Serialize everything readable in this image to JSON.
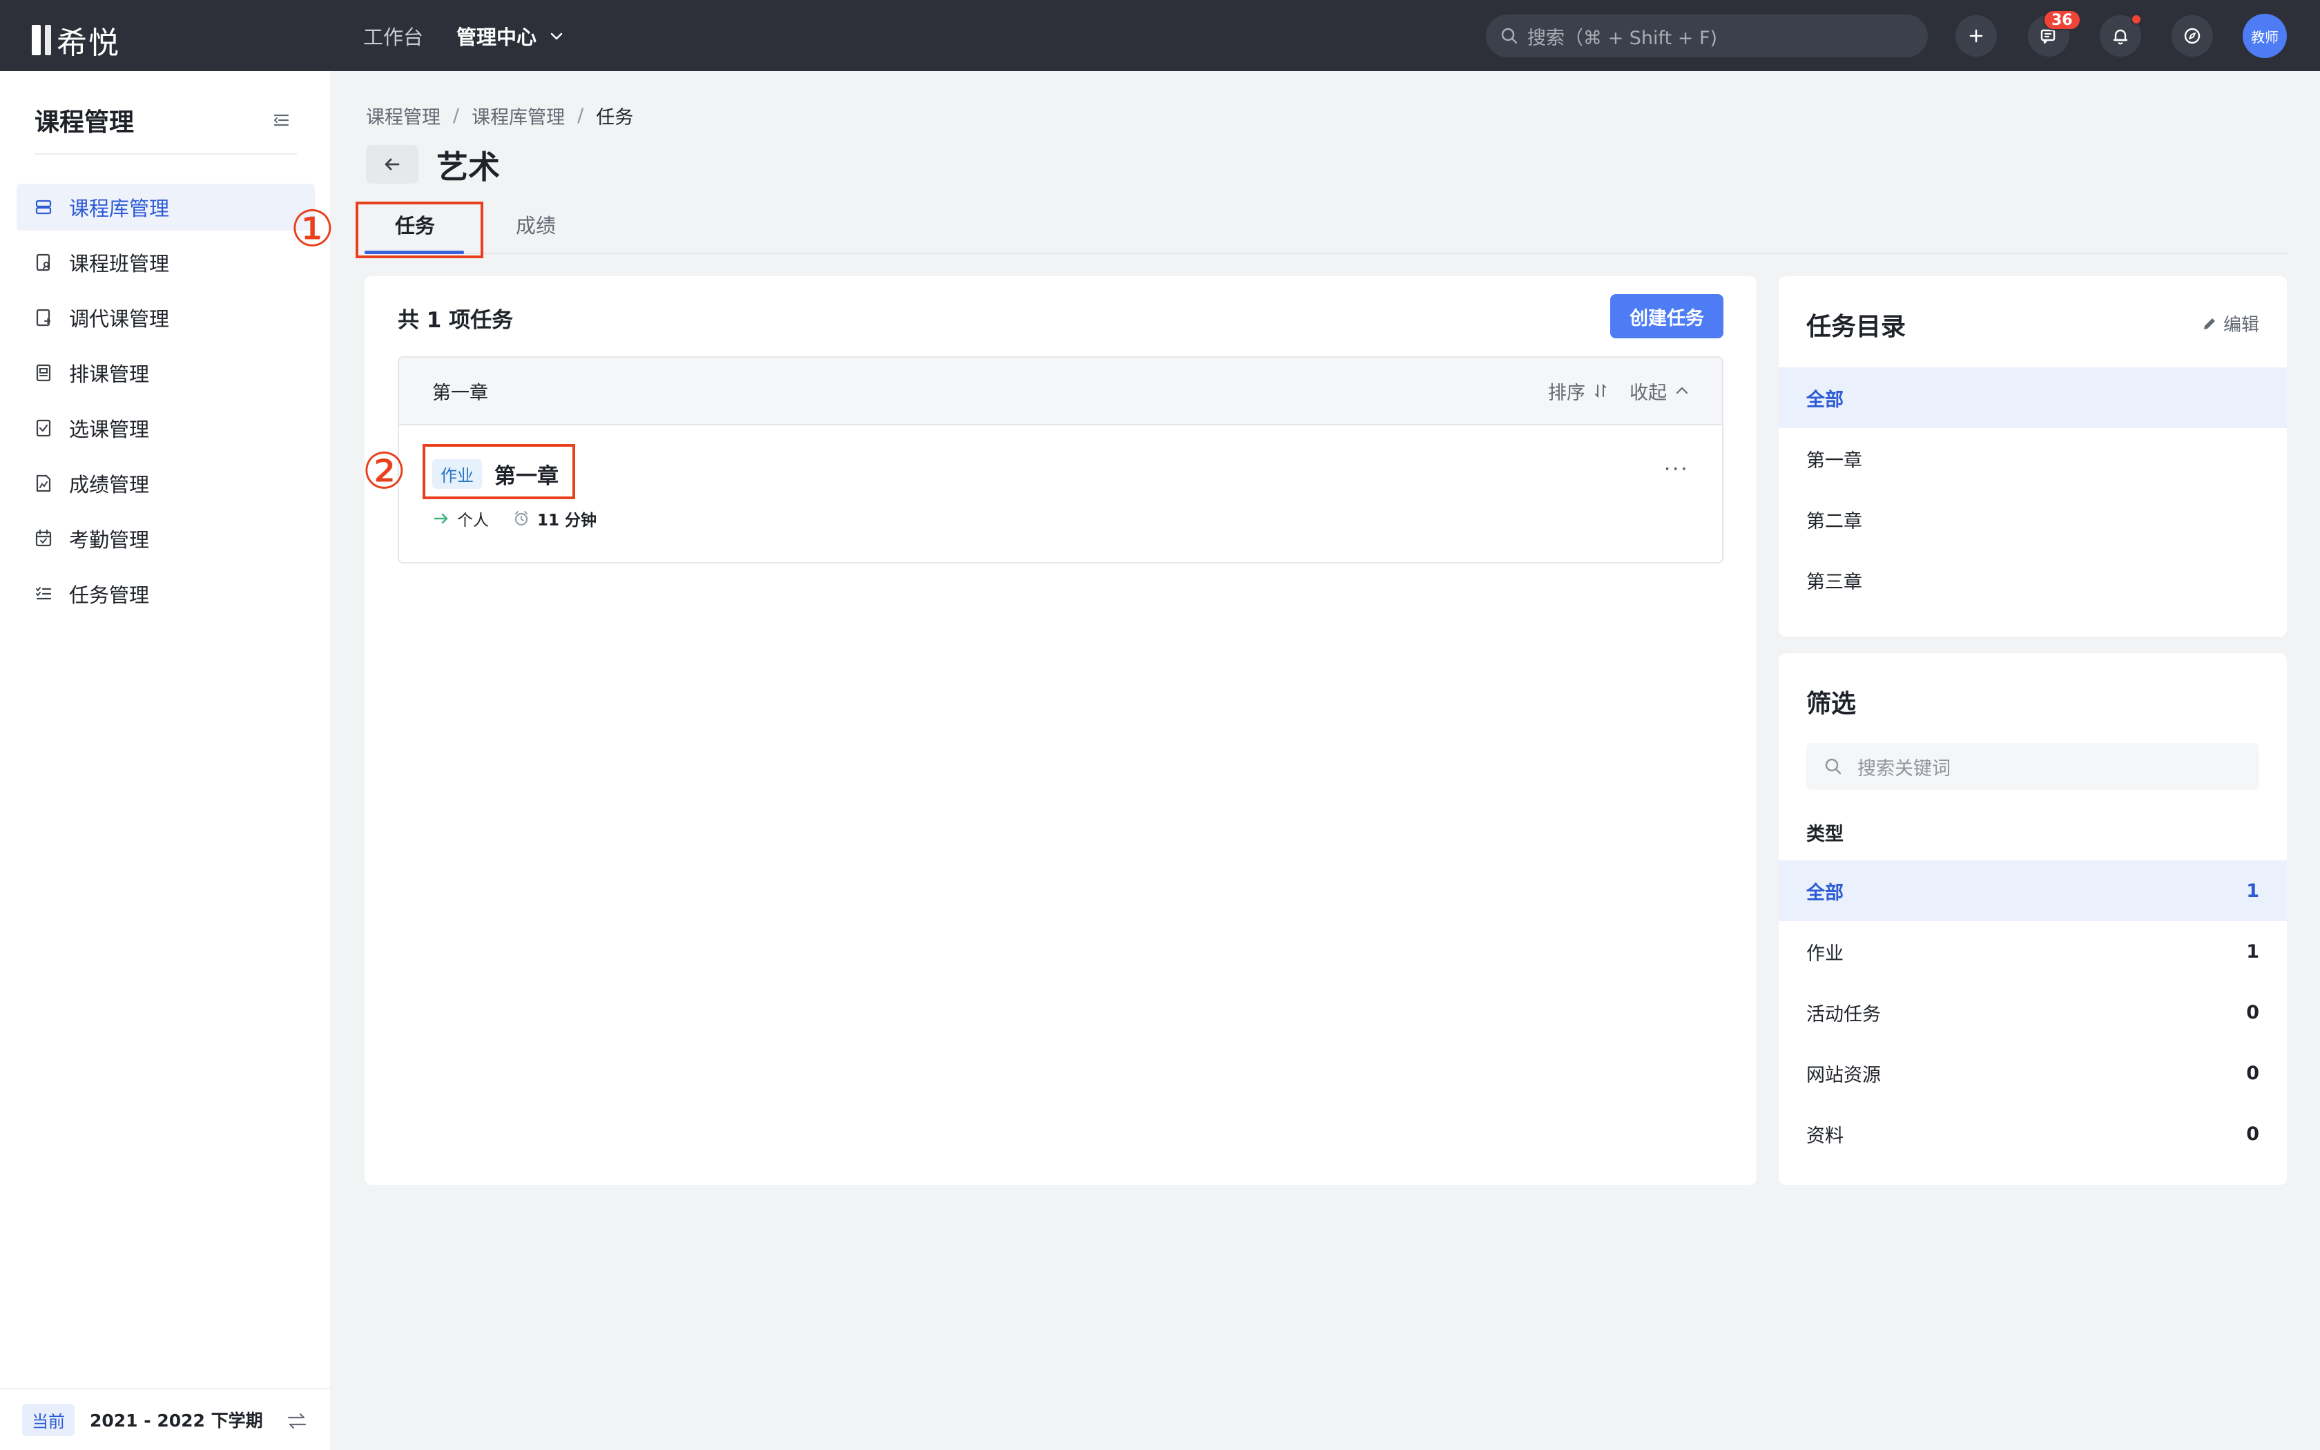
{
  "app": {
    "brand": "希悦"
  },
  "topnav": {
    "workbench": "工作台",
    "admin_center": "管理中心"
  },
  "search": {
    "placeholder": "搜索（⌘ + Shift + F)"
  },
  "notifications": {
    "message_count": "36"
  },
  "user": {
    "avatar_text": "教师"
  },
  "sidebar": {
    "title": "课程管理",
    "items": [
      {
        "label": "课程库管理",
        "icon": "database-icon",
        "active": true
      },
      {
        "label": "课程班管理",
        "icon": "class-icon"
      },
      {
        "label": "调代课管理",
        "icon": "substitute-icon"
      },
      {
        "label": "排课管理",
        "icon": "schedule-icon"
      },
      {
        "label": "选课管理",
        "icon": "checklist-icon"
      },
      {
        "label": "成绩管理",
        "icon": "grade-icon"
      },
      {
        "label": "考勤管理",
        "icon": "calendar-icon"
      },
      {
        "label": "任务管理",
        "icon": "task-list-icon"
      }
    ],
    "footer": {
      "tag": "当前",
      "term": "2021 - 2022 下学期"
    }
  },
  "breadcrumb": [
    "课程管理",
    "课程库管理",
    "任务"
  ],
  "page": {
    "title": "艺术"
  },
  "tabs": [
    {
      "label": "任务",
      "active": true
    },
    {
      "label": "成绩"
    }
  ],
  "annotations": {
    "one": "①",
    "two": "②"
  },
  "content": {
    "count_text": "共 1 项任务",
    "create_button": "创建任务",
    "chapter": {
      "name": "第一章",
      "sort_label": "排序",
      "collapse_label": "收起",
      "tasks": [
        {
          "type": "作业",
          "name": "第一章",
          "scope": "个人",
          "duration": "11 分钟",
          "more": "···"
        }
      ]
    }
  },
  "catalog": {
    "title": "任务目录",
    "edit_label": "编辑",
    "items": [
      "全部",
      "第一章",
      "第二章",
      "第三章"
    ]
  },
  "filter": {
    "title": "筛选",
    "search_placeholder": "搜索关键词",
    "type_label": "类型",
    "types": [
      {
        "label": "全部",
        "count": "1"
      },
      {
        "label": "作业",
        "count": "1"
      },
      {
        "label": "活动任务",
        "count": "0"
      },
      {
        "label": "网站资源",
        "count": "0"
      },
      {
        "label": "资料",
        "count": "0"
      }
    ]
  },
  "colors": {
    "accent": "#4d7cf4",
    "topbar": "#2d3039",
    "annotation": "#e8401c",
    "active_text": "#2d5bd4"
  }
}
